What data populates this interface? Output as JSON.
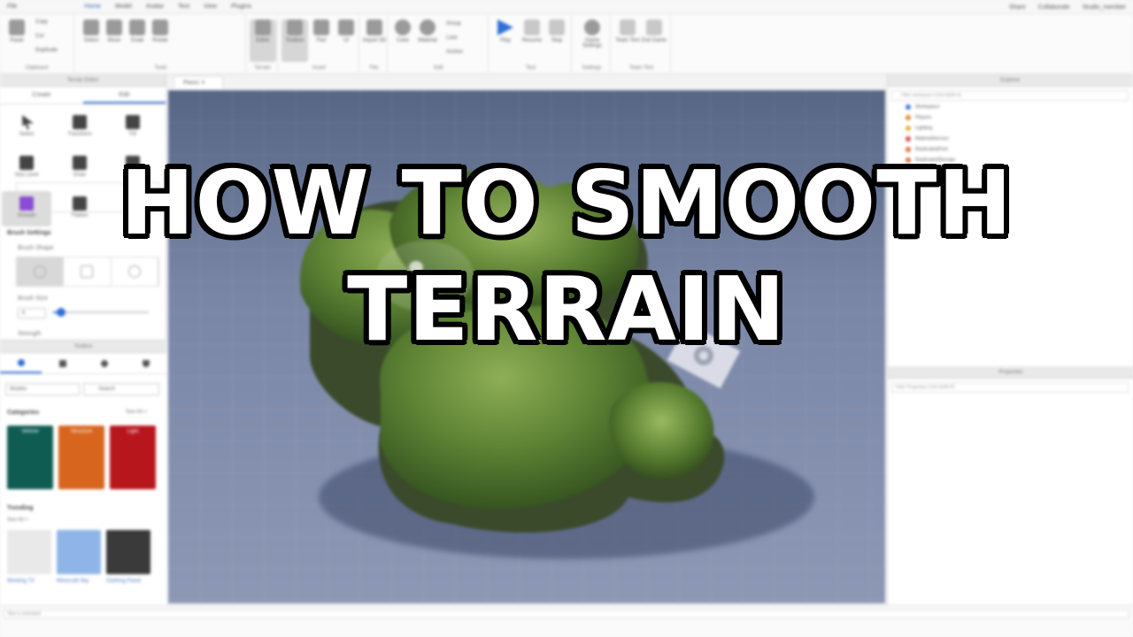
{
  "headline": "HOW TO SMOOTH TERRAIN",
  "menubar": {
    "items": [
      "File",
      "Home",
      "Model",
      "Avatar",
      "Test",
      "View",
      "Plugins"
    ],
    "active_index": 1,
    "right": [
      "Share",
      "Collaborate",
      "Studio_member"
    ]
  },
  "ribbon": {
    "groups": [
      {
        "label": "Clipboard",
        "tools": [
          "Paste",
          "Copy",
          "Cut",
          "Duplicate"
        ]
      },
      {
        "label": "Tools",
        "tools": [
          "Select",
          "Move",
          "Scale",
          "Rotate"
        ]
      },
      {
        "label": "Terrain",
        "tools": [
          "Editor"
        ]
      },
      {
        "label": "Insert",
        "tools": [
          "Toolbox",
          "Part",
          "UI"
        ]
      },
      {
        "label": "File",
        "tools": [
          "Import 3D"
        ]
      },
      {
        "label": "Edit",
        "tools": [
          "Color",
          "Material",
          "Group",
          "Lock",
          "Anchor"
        ]
      },
      {
        "label": "Test",
        "tools": [
          "Play",
          "Resume",
          "Stop"
        ]
      },
      {
        "label": "Settings",
        "tools": [
          "Game Settings"
        ]
      },
      {
        "label": "Team Test",
        "tools": [
          "Team Test",
          "Exit Game"
        ]
      }
    ]
  },
  "terrain_editor": {
    "title": "Terrain Editor",
    "tabs": [
      "Create",
      "Edit"
    ],
    "active_tab": 1,
    "tools": [
      "Select",
      "Transform",
      "Fill",
      "Sea Level",
      "Draw",
      "Sculpt",
      "Smooth",
      "Flatten",
      "Paint"
    ],
    "selected_tool": 6,
    "brush_settings": "Brush Settings",
    "brush_shape": "Brush Shape",
    "brush_size": "Brush Size",
    "brush_size_value": "6",
    "strength": "Strength"
  },
  "toolbox": {
    "title": "Toolbox",
    "category_dropdown": "Models",
    "search_placeholder": "Search",
    "categories_title": "Categories",
    "see_all": "See All >",
    "categories": [
      {
        "label": "Vehicle",
        "color": "#0f5d52"
      },
      {
        "label": "Structure",
        "color": "#d8651e"
      },
      {
        "label": "Light",
        "color": "#b8161d"
      }
    ],
    "trending_title": "Trending",
    "trending_see_all": "See All >",
    "trending": [
      "Working TV",
      "Minecraft Sky",
      "Clothing Panel"
    ]
  },
  "viewport": {
    "tab_label": "Place1"
  },
  "explorer": {
    "title": "Explorer",
    "filter_placeholder": "Filter workspace (Ctrl+Shift+X)",
    "items": [
      {
        "label": "Workspace",
        "color": "#3a7bd5"
      },
      {
        "label": "Players",
        "color": "#e08a2a"
      },
      {
        "label": "Lighting",
        "color": "#e0b02a"
      },
      {
        "label": "MaterialService",
        "color": "#d04a4a"
      },
      {
        "label": "ReplicatedFirst",
        "color": "#e06a3a"
      },
      {
        "label": "ReplicatedStorage",
        "color": "#e06a3a"
      }
    ]
  },
  "properties": {
    "title": "Properties",
    "filter_placeholder": "Filter Properties (Ctrl+Shift+P)"
  },
  "command_bar": {
    "placeholder": "Run a command"
  }
}
